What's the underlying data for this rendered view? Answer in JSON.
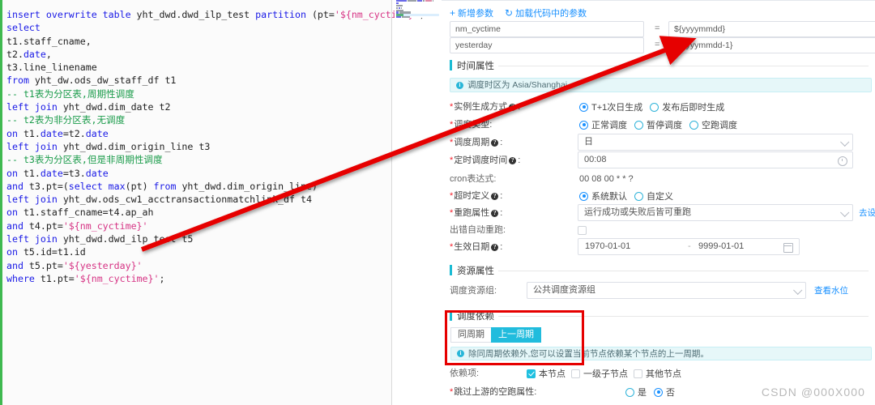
{
  "editor": {
    "language": "sql",
    "colors": {
      "keyword": "#1a1ae6",
      "identifier": "#222222",
      "comment": "#1a9b4a",
      "string": "#d63384",
      "variable": "#e83e8c"
    },
    "lines": [
      [
        {
          "t": "insert overwrite table ",
          "c": "kw"
        },
        {
          "t": "yht_dwd.dwd_ilp_test ",
          "c": "id"
        },
        {
          "t": "partition ",
          "c": "kw"
        },
        {
          "t": "(pt=",
          "c": "op"
        },
        {
          "t": "'${nm_cyctime}'",
          "c": "st"
        },
        {
          "t": ")",
          "c": "op"
        }
      ],
      [
        {
          "t": "select",
          "c": "kw"
        }
      ],
      [
        {
          "t": "t1.staff_cname,",
          "c": "id"
        }
      ],
      [
        {
          "t": "t2.",
          "c": "id"
        },
        {
          "t": "date",
          "c": "kw"
        },
        {
          "t": ",",
          "c": "id"
        }
      ],
      [
        {
          "t": "t3.line_linename",
          "c": "id"
        }
      ],
      [
        {
          "t": "from ",
          "c": "kw"
        },
        {
          "t": "yht_dw.ods_dw_staff_df t1",
          "c": "id"
        }
      ],
      [
        {
          "t": "-- t1表为分区表,周期性调度",
          "c": "cm"
        }
      ],
      [
        {
          "t": "left join ",
          "c": "kw"
        },
        {
          "t": "yht_dwd.dim_date t2",
          "c": "id"
        }
      ],
      [
        {
          "t": "-- t2表为非分区表,无调度",
          "c": "cm"
        }
      ],
      [
        {
          "t": "on ",
          "c": "kw"
        },
        {
          "t": "t1.",
          "c": "id"
        },
        {
          "t": "date",
          "c": "kw"
        },
        {
          "t": "=t2.",
          "c": "id"
        },
        {
          "t": "date",
          "c": "kw"
        }
      ],
      [
        {
          "t": "left join ",
          "c": "kw"
        },
        {
          "t": "yht_dwd.dim_origin_line t3",
          "c": "id"
        }
      ],
      [
        {
          "t": "-- t3表为分区表,但是非周期性调度",
          "c": "cm"
        }
      ],
      [
        {
          "t": "on ",
          "c": "kw"
        },
        {
          "t": "t1.",
          "c": "id"
        },
        {
          "t": "date",
          "c": "kw"
        },
        {
          "t": "=t3.",
          "c": "id"
        },
        {
          "t": "date",
          "c": "kw"
        }
      ],
      [
        {
          "t": "and ",
          "c": "kw"
        },
        {
          "t": "t3.pt=(",
          "c": "id"
        },
        {
          "t": "select ",
          "c": "kw"
        },
        {
          "t": "max",
          "c": "fn"
        },
        {
          "t": "(pt) ",
          "c": "id"
        },
        {
          "t": "from ",
          "c": "kw"
        },
        {
          "t": "yht_dwd.dim_origin_line)",
          "c": "id"
        }
      ],
      [
        {
          "t": "left join ",
          "c": "kw"
        },
        {
          "t": "yht_dw.ods_cw1_acctransactionmatchlink_df t4",
          "c": "id"
        }
      ],
      [
        {
          "t": "on ",
          "c": "kw"
        },
        {
          "t": "t1.staff_cname=t4.ap_ah",
          "c": "id"
        }
      ],
      [
        {
          "t": "and ",
          "c": "kw"
        },
        {
          "t": "t4.pt=",
          "c": "id"
        },
        {
          "t": "'${nm_cyctime}'",
          "c": "st"
        }
      ],
      [
        {
          "t": "left join ",
          "c": "kw"
        },
        {
          "t": "yht_dwd.dwd_ilp_test t5",
          "c": "id"
        }
      ],
      [
        {
          "t": "on ",
          "c": "kw"
        },
        {
          "t": "t5.id=t1.id",
          "c": "id"
        }
      ],
      [
        {
          "t": "and ",
          "c": "kw"
        },
        {
          "t": "t5.pt=",
          "c": "id"
        },
        {
          "t": "'${yesterday}'",
          "c": "st"
        }
      ],
      [
        {
          "t": "where ",
          "c": "kw"
        },
        {
          "t": "t1.pt=",
          "c": "id"
        },
        {
          "t": "'${nm_cyctime}'",
          "c": "st"
        },
        {
          "t": ";",
          "c": "id"
        }
      ]
    ]
  },
  "panel": {
    "actions": [
      {
        "icon": "plus-icon",
        "glyph": "+",
        "label": "新增参数"
      },
      {
        "icon": "refresh-icon",
        "glyph": "↻",
        "label": "加载代码中的参数"
      }
    ],
    "parameters": [
      {
        "name": "nm_cyctime",
        "eq": "=",
        "value": "${yyyymmdd}"
      },
      {
        "name": "yesterday",
        "eq": "=",
        "value": "${yyyymmdd-1}"
      }
    ],
    "time_section": {
      "title": "时间属性",
      "timezone_notice": "调度时区为 Asia/Shanghai",
      "instance_mode": {
        "label": "实例生成方式",
        "options": [
          "T+1次日生成",
          "发布后即时生成"
        ],
        "selected": 0
      },
      "schedule_type": {
        "label": "调度类型",
        "options": [
          "正常调度",
          "暂停调度",
          "空跑调度"
        ],
        "selected": 0
      },
      "period": {
        "label": "调度周期",
        "value": "日"
      },
      "run_time": {
        "label": "定时调度时间",
        "value": "00:08"
      },
      "cron": {
        "label": "cron表达式",
        "value": "00 08 00 * * ?"
      },
      "timeout": {
        "label": "超时定义",
        "options": [
          "系统默认",
          "自定义"
        ],
        "selected": 0
      },
      "rerun": {
        "label": "重跑属性",
        "value": "运行成功或失败后皆可重跑",
        "link": "去设置默认重跑属性值"
      },
      "auto_rerun": {
        "label": "出错自动重跑",
        "checked": false
      },
      "effective_date": {
        "label": "生效日期",
        "start": "1970-01-01",
        "sep": "-",
        "end": "9999-01-01"
      }
    },
    "resource_section": {
      "title": "资源属性",
      "group": {
        "label": "调度资源组",
        "value": "公共调度资源组",
        "link": "查看水位"
      }
    },
    "dependency_section": {
      "title": "调度依赖",
      "tabs": [
        {
          "label": "同周期",
          "active": false
        },
        {
          "label": "上一周期",
          "active": true
        }
      ],
      "notice": "除同周期依赖外,您可以设置当前节点依赖某个节点的上一周期。",
      "depend_items": {
        "label": "依赖项",
        "items": [
          {
            "label": "本节点",
            "checked": true
          },
          {
            "label": "一级子节点",
            "checked": false
          },
          {
            "label": "其他节点",
            "checked": false
          }
        ]
      },
      "skip_upstream": {
        "label": "跳过上游的空跑属性",
        "options": [
          "是",
          "否"
        ],
        "selected": 1
      }
    }
  },
  "annotations": {
    "arrow_color": "#e60000",
    "box_color": "#e60000",
    "watermark": "CSDN @000X000"
  }
}
